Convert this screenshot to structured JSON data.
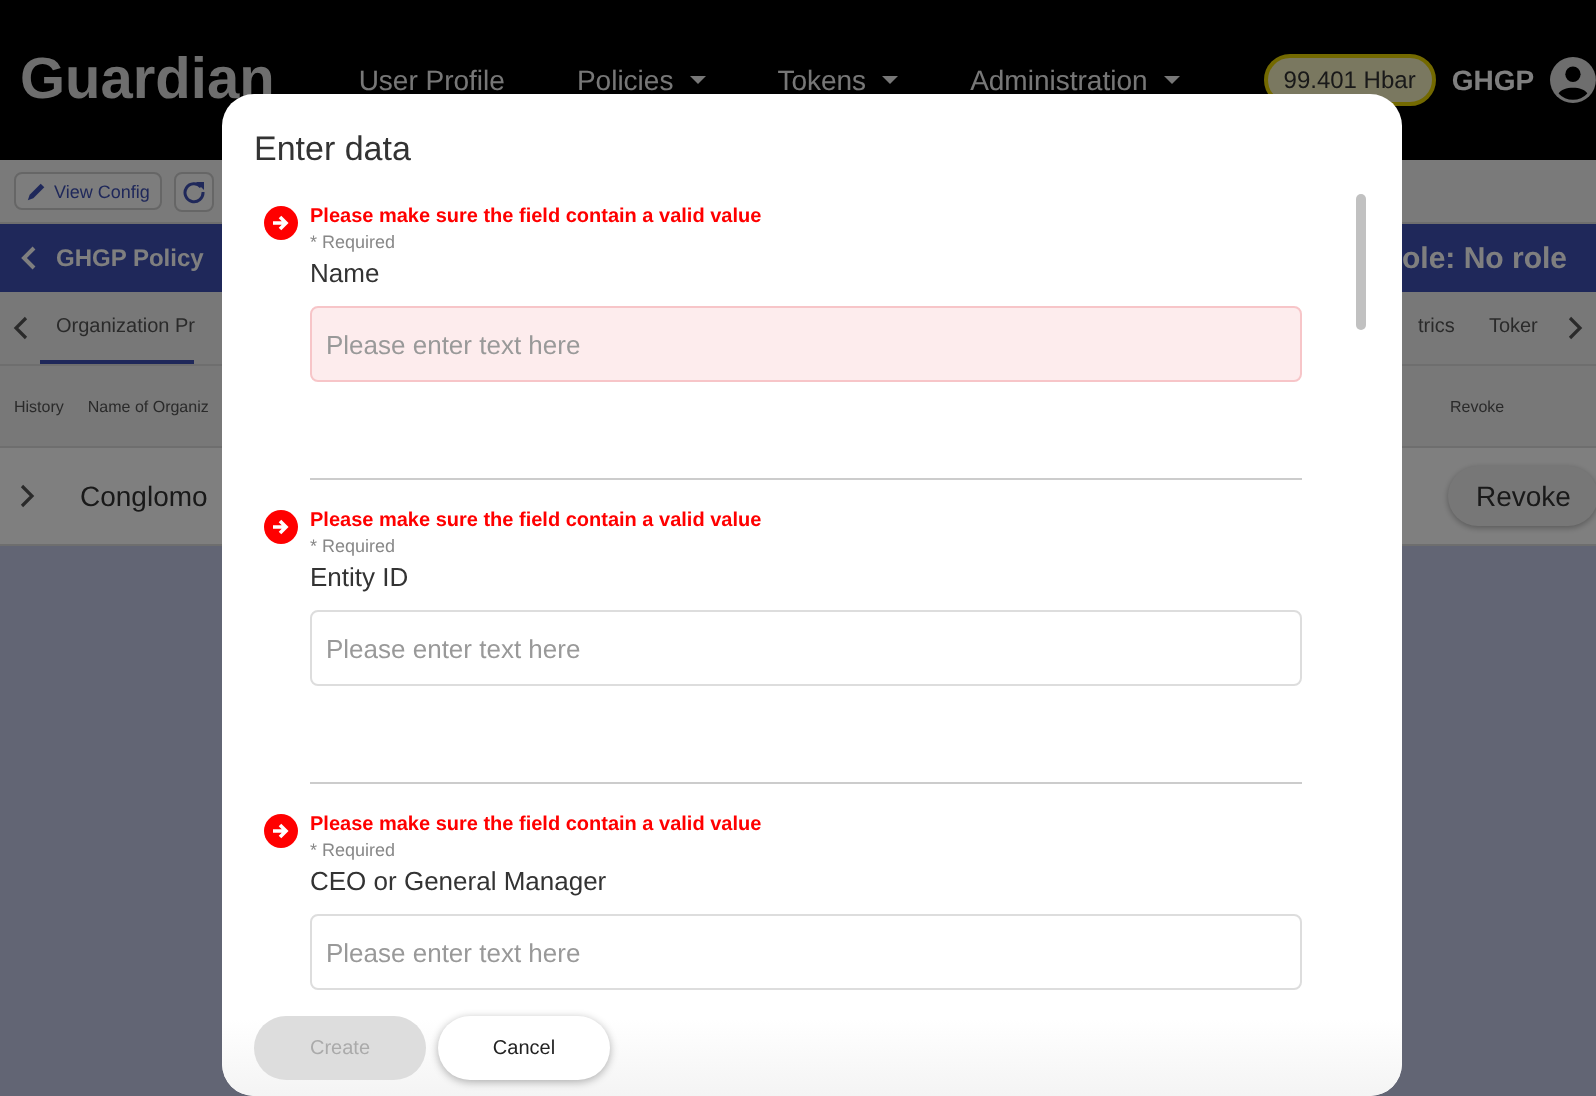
{
  "header": {
    "logo": "Guardian",
    "nav": [
      {
        "label": "User Profile",
        "dropdown": false
      },
      {
        "label": "Policies",
        "dropdown": true
      },
      {
        "label": "Tokens",
        "dropdown": true
      },
      {
        "label": "Administration",
        "dropdown": true
      }
    ],
    "balance": "99.401 Hbar",
    "user": "GHGP"
  },
  "toolbar": {
    "view_config": "View Config"
  },
  "policy_bar": {
    "title": "GHGP Policy",
    "role": "ole: No role"
  },
  "tabs": {
    "left": [
      {
        "label": "Organization Pr",
        "selected": true
      }
    ],
    "right": [
      {
        "label": "trics",
        "selected": false
      },
      {
        "label": "Toker",
        "selected": false
      }
    ]
  },
  "table": {
    "columns_left": [
      "History",
      "Name of Organiz"
    ],
    "columns_right": [
      "Revoke"
    ],
    "rows": [
      {
        "name": "Conglomo",
        "action": "Revoke"
      }
    ]
  },
  "dialog": {
    "title": "Enter data",
    "fields": [
      {
        "error": "Please make sure the field contain a valid value",
        "required": "* Required",
        "label": "Name",
        "placeholder": "Please enter text here",
        "invalid": true
      },
      {
        "error": "Please make sure the field contain a valid value",
        "required": "* Required",
        "label": "Entity ID",
        "placeholder": "Please enter text here",
        "invalid": false
      },
      {
        "error": "Please make sure the field contain a valid value",
        "required": "* Required",
        "label": "CEO or General Manager",
        "placeholder": "Please enter text here",
        "invalid": false
      }
    ],
    "buttons": [
      {
        "label": "Create",
        "disabled": true
      },
      {
        "label": "Cancel",
        "disabled": false
      }
    ]
  }
}
